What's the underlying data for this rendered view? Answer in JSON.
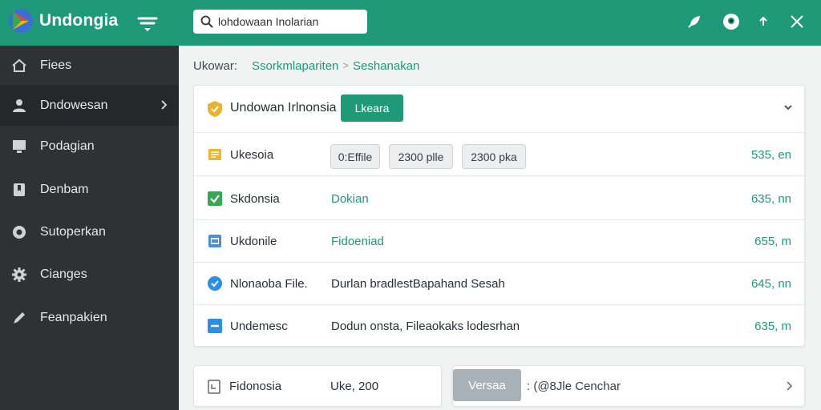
{
  "app": {
    "name": "Undongia",
    "accent": "#1f9a78",
    "sidebar_bg": "#2e3235"
  },
  "search": {
    "value": "lohdowaan Inolarian"
  },
  "toolbar": {
    "icons": [
      "rocket-icon",
      "user-circle-icon",
      "upload-icon",
      "close-icon"
    ]
  },
  "sidebar": {
    "items": [
      {
        "label": "Fiees",
        "icon": "home-icon"
      },
      {
        "label": "Dndowesan",
        "icon": "user-icon",
        "active": true
      },
      {
        "label": "Podagian",
        "icon": "monitor-icon"
      },
      {
        "label": "Denbam",
        "icon": "bookmark-icon"
      },
      {
        "label": "Sutoperkan",
        "icon": "circle-icon"
      },
      {
        "label": "Cianges",
        "icon": "gear-icon"
      },
      {
        "label": "Feanpakien",
        "icon": "pencil-icon"
      }
    ]
  },
  "breadcrumb": {
    "root": "Ukowar:",
    "link": "Ssorkmlapariten",
    "separator": ">",
    "current": "Seshanakan"
  },
  "card": {
    "title": "Undowan Irlnonsia",
    "button": "Lkeara",
    "rows": [
      {
        "icon": "document-icon",
        "name": "Ukesoia",
        "chips": [
          "0:Effile",
          "2300 plle",
          "2300 pka"
        ],
        "value": "535, en"
      },
      {
        "icon": "checkbox-icon",
        "name": "Skdonsia",
        "desc": "Dokian",
        "value": "635, nn"
      },
      {
        "icon": "window-icon",
        "name": "Ukdonile",
        "desc": "Fidoeniad",
        "value": "655, m"
      },
      {
        "icon": "check-circle-icon",
        "name": "Nlonaoba File.",
        "desc": "Durlan bradlestBapahand Sesah",
        "value": "645, nn"
      },
      {
        "icon": "minus-square-icon",
        "name": "Undemesc",
        "desc": "Dodun onsta, Fileaokaks lodesrhan",
        "value": "635, m"
      }
    ]
  },
  "bottom": {
    "left": {
      "icon": "file-icon",
      "name": "Fidonosia",
      "value": "Uke, 200"
    },
    "right": {
      "button": "Versaa",
      "label": ": (@8Jle Cenchar"
    }
  }
}
